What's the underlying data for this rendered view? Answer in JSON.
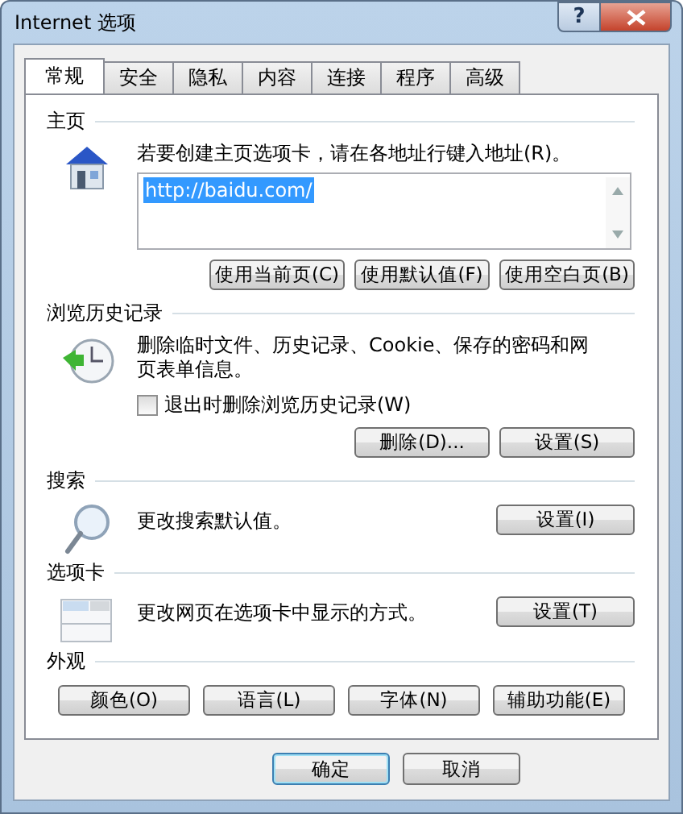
{
  "window": {
    "title": "Internet 选项",
    "help": "?"
  },
  "tabs": [
    {
      "label": "常规",
      "selected": true
    },
    {
      "label": "安全",
      "selected": false
    },
    {
      "label": "隐私",
      "selected": false
    },
    {
      "label": "内容",
      "selected": false
    },
    {
      "label": "连接",
      "selected": false
    },
    {
      "label": "程序",
      "selected": false
    },
    {
      "label": "高级",
      "selected": false
    }
  ],
  "homepage": {
    "heading": "主页",
    "prompt": "若要创建主页选项卡，请在各地址行键入地址(R)。",
    "value": "http://baidu.com/",
    "value_selected": true,
    "buttons": [
      "使用当前页(C)",
      "使用默认值(F)",
      "使用空白页(B)"
    ]
  },
  "history": {
    "heading": "浏览历史记录",
    "description": "删除临时文件、历史记录、Cookie、保存的密码和网页表单信息。",
    "checkbox": {
      "label": "退出时删除浏览历史记录(W)",
      "checked": false
    },
    "buttons": [
      "删除(D)...",
      "设置(S)"
    ]
  },
  "search": {
    "heading": "搜索",
    "description": "更改搜索默认值。",
    "button": "设置(I)"
  },
  "tabs_section": {
    "heading": "选项卡",
    "description": "更改网页在选项卡中显示的方式。",
    "button": "设置(T)"
  },
  "appearance": {
    "heading": "外观",
    "buttons": [
      "颜色(O)",
      "语言(L)",
      "字体(N)",
      "辅助功能(E)"
    ]
  },
  "dialog_buttons": [
    {
      "label": "确定",
      "default": true
    },
    {
      "label": "取消",
      "default": false
    }
  ]
}
